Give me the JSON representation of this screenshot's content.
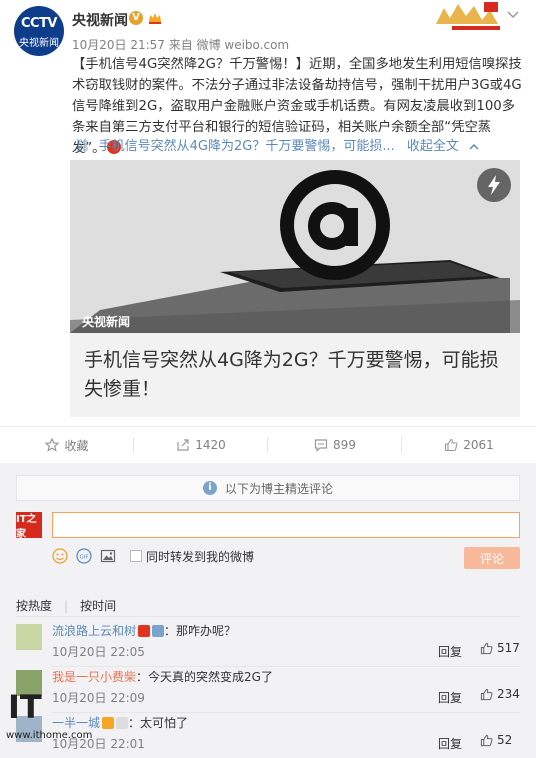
{
  "post": {
    "avatar_top": "CCTV",
    "avatar_bottom": "央视新闻",
    "username": "央视新闻",
    "verified_badge": "V",
    "meta": "10月20日 21:57 来自 微博 weibo.com",
    "body": "【手机信号4G突然降2G？千万警惕！】近期，全国多地发生利用短信嗅探技术窃取钱财的案件。不法分子通过非法设备劫持信号，强制干扰用户3G或4G信号降维到2G，盗取用户金融账户资金或手机话费。有网友凌晨收到100多条来自第三方支付平台和银行的短信验证码，相关账户余额全部“凭空蒸发”。",
    "link_text": "手机信号突然从4G降为2G？千万要警惕，可能损...",
    "collapse_label": "收起全文",
    "article_source": "央视新闻",
    "article_title": "手机信号突然从4G降为2G？千万要警惕，可能损失惨重！"
  },
  "actions": {
    "favorite": "收藏",
    "repost": "1420",
    "comment": "899",
    "like": "2061"
  },
  "comments_area": {
    "notice": "以下为博主精选评论",
    "input_placeholder": "",
    "my_avatar_text": "IT之家",
    "repost_checkbox_label": "同时转发到我的微博",
    "submit_label": "评论",
    "sort_hot": "按热度",
    "sort_time": "按时间",
    "reply_label": "回复",
    "items": [
      {
        "user": "流浪路上云和树",
        "text": "：那咋办呢？",
        "time": "10月20日 22:05",
        "likes": "517"
      },
      {
        "user": "我是一只小费柴",
        "text": "：今天真的突然变成2G了",
        "time": "10月20日 22:09",
        "likes": "234"
      },
      {
        "user": "一半一城",
        "text": "：太可怕了",
        "time": "10月20日 22:01",
        "likes": "52"
      }
    ]
  },
  "watermark": {
    "brand": "IT之家",
    "url": "www.ithome.com"
  },
  "colors": {
    "link": "#5c8ab8",
    "username_orange": "#eb7350",
    "input_border": "#f8a15b",
    "submit_bg": "#f8b89a",
    "brand_red": "#d52b1e"
  },
  "icons": [
    "crown-icon",
    "chevron-down-icon",
    "chain-link-icon",
    "lightning-icon",
    "star-icon",
    "repost-icon",
    "comment-icon",
    "thumb-up-icon",
    "info-icon",
    "emoji-icon",
    "gif-icon",
    "image-icon"
  ]
}
